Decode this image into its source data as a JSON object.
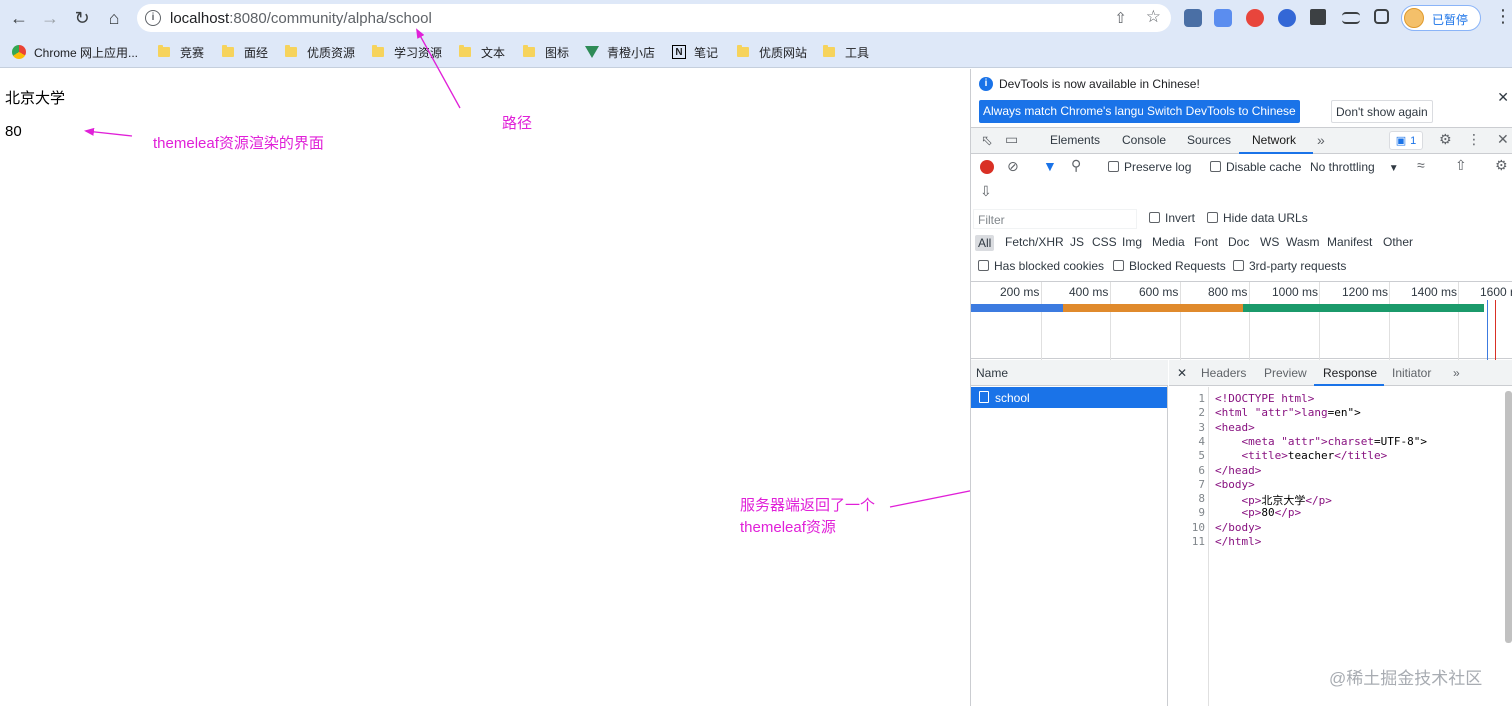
{
  "browser": {
    "url_host": "localhost",
    "url_rest": ":8080/community/alpha/school",
    "profile_label": "已暂停"
  },
  "bookmarks": [
    {
      "label": "Chrome 网上应用..."
    },
    {
      "label": "竞赛"
    },
    {
      "label": "面经"
    },
    {
      "label": "优质资源"
    },
    {
      "label": "学习资源"
    },
    {
      "label": "文本"
    },
    {
      "label": "图标"
    },
    {
      "label": "青橙小店"
    },
    {
      "label": "笔记"
    },
    {
      "label": "优质网站"
    },
    {
      "label": "工具"
    }
  ],
  "page": {
    "line1": "北京大学",
    "line2": "80"
  },
  "annotations": {
    "render_note": "themeleaf资源渲染的界面",
    "path_note": "路径",
    "server_note_1": "服务器端返回了一个",
    "server_note_2": "themeleaf资源",
    "color": "#e020d8"
  },
  "devtools": {
    "info_message": "DevTools is now available in Chinese!",
    "btn_match": "Always match Chrome's language",
    "btn_switch": "Switch DevTools to Chinese",
    "btn_dont_show": "Don't show again",
    "tabs": {
      "elements": "Elements",
      "console": "Console",
      "sources": "Sources",
      "network": "Network"
    },
    "issues_count": "1",
    "preserve_log": "Preserve log",
    "disable_cache": "Disable cache",
    "throttling": "No throttling",
    "filter_placeholder": "Filter",
    "invert": "Invert",
    "hide_data_urls": "Hide data URLs",
    "types": [
      "All",
      "Fetch/XHR",
      "JS",
      "CSS",
      "Img",
      "Media",
      "Font",
      "Doc",
      "WS",
      "Wasm",
      "Manifest",
      "Other"
    ],
    "has_blocked_cookies": "Has blocked cookies",
    "blocked_requests": "Blocked Requests",
    "third_party": "3rd-party requests",
    "timeline_ticks": [
      "200 ms",
      "400 ms",
      "600 ms",
      "800 ms",
      "1000 ms",
      "1200 ms",
      "1400 ms",
      "1600 r"
    ],
    "name_header": "Name",
    "request_name": "school",
    "detail_tabs": {
      "headers": "Headers",
      "preview": "Preview",
      "response": "Response",
      "initiator": "Initiator"
    },
    "response_lines": [
      "<!DOCTYPE html>",
      "<html lang=\"en\">",
      "<head>",
      "    <meta charset=\"UTF-8\">",
      "    <title>teacher</title>",
      "</head>",
      "<body>",
      "    <p>北京大学</p>",
      "    <p>80</p>",
      "</body>",
      "</html>"
    ]
  },
  "watermark": "@稀土掘金技术社区"
}
